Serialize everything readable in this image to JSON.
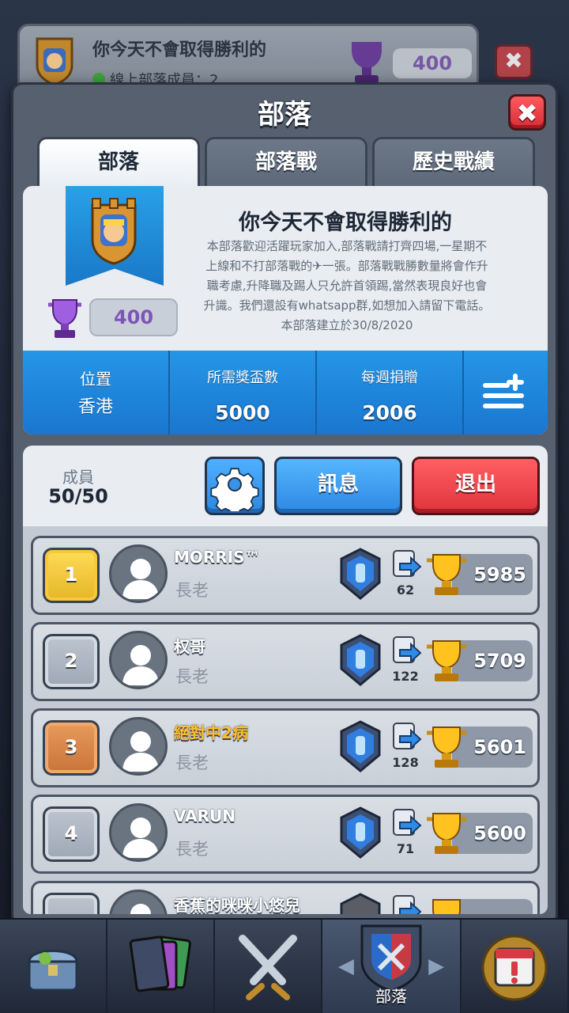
{
  "background_card": {
    "clan_name": "你今天不會取得勝利的",
    "online_text": "線上部落成員：2",
    "trophies": "400"
  },
  "modal": {
    "title": "部落",
    "tabs": [
      {
        "label": "部落",
        "active": true
      },
      {
        "label": "部落戰",
        "active": false
      },
      {
        "label": "歷史戰績",
        "active": false
      }
    ]
  },
  "clan": {
    "name": "你今天不會取得勝利的",
    "description_lines": [
      "本部落歡迎活躍玩家加入,部落戰請打齊四場,一星期不",
      "上線和不打部落戰的✈一張。部落戰戰勝數量將會作升",
      "職考慮,升降職及踢人只允許首領踢,當然表現良好也會",
      "升識。我們還設有whatsapp群,如想加入請留下電話。",
      "本部落建立於30/8/2020"
    ],
    "trophies": "400",
    "stats": {
      "location_label": "位置",
      "location_value": "香港",
      "required_label": "所需獎盃數",
      "required_value": "5000",
      "donations_label": "每週捐贈",
      "donations_value": "2006"
    }
  },
  "members_header": {
    "label": "成員",
    "count": "50/50",
    "message_button": "訊息",
    "leave_button": "退出"
  },
  "members": [
    {
      "rank": "1",
      "name": "MORRIS™",
      "role": "長老",
      "donations": "62",
      "trophies": "5985",
      "name_color": "white"
    },
    {
      "rank": "2",
      "name": "权哥",
      "role": "長老",
      "donations": "122",
      "trophies": "5709",
      "name_color": "white"
    },
    {
      "rank": "3",
      "name": "絕對中2病",
      "role": "長老",
      "donations": "128",
      "trophies": "5601",
      "name_color": "gold"
    },
    {
      "rank": "4",
      "name": "VARUN",
      "role": "長老",
      "donations": "71",
      "trophies": "5600",
      "name_color": "white"
    },
    {
      "rank": "",
      "name": "香蕉的咪咪小悠兒",
      "role": "",
      "donations": "",
      "trophies": "",
      "name_color": "white"
    }
  ],
  "bottom_nav": {
    "active_label": "部落"
  },
  "colors": {
    "accent_blue": "#1f86d8",
    "leave_red": "#e0333b",
    "trophy_purple": "#7d55b9",
    "rank_gold": "#e5b527",
    "rank_bronze": "#c9733a"
  }
}
